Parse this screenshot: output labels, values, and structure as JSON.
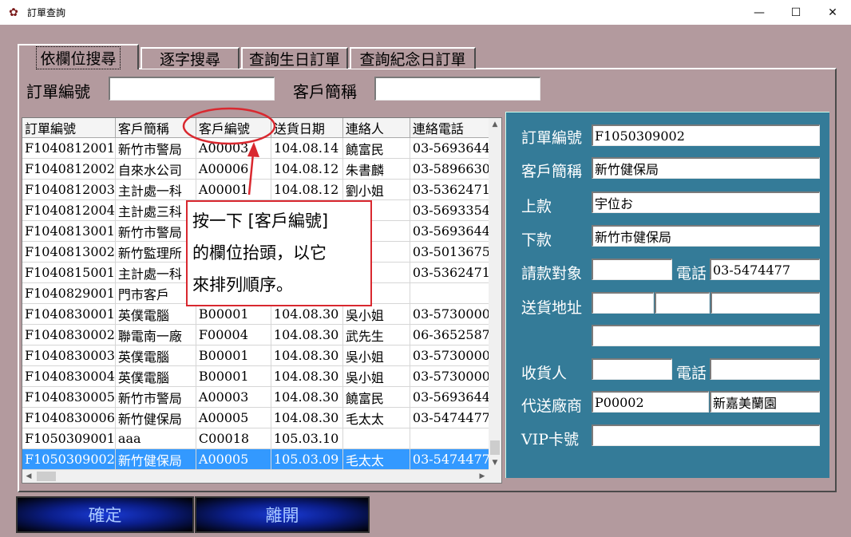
{
  "window": {
    "title": "訂單查詢",
    "minimize": "—",
    "maximize": "☐",
    "close": "✕"
  },
  "tabs": [
    {
      "label": "依欄位搜尋",
      "active": true
    },
    {
      "label": "逐字搜尋",
      "active": false
    },
    {
      "label": "查詢生日訂單",
      "active": false
    },
    {
      "label": "查詢紀念日訂單",
      "active": false
    }
  ],
  "search": {
    "order_no_label": "訂單編號",
    "order_no_value": "",
    "customer_label": "客戶簡稱",
    "customer_value": ""
  },
  "grid": {
    "columns": [
      "訂單編號",
      "客戶簡稱",
      "客戶編號",
      "送貨日期",
      "連絡人",
      "連絡電話"
    ],
    "rows": [
      [
        "F1040812001",
        "新竹市警局",
        "A00003",
        "104.08.14",
        "饒富民",
        "03-5693644"
      ],
      [
        "F1040812002",
        "自來水公司",
        "A00006",
        "104.08.12",
        "朱書麟",
        "03-5896630"
      ],
      [
        "F1040812003",
        "主計處一科",
        "A00001",
        "104.08.12",
        "劉小姐",
        "03-5362471"
      ],
      [
        "F1040812004",
        "主計處三科",
        "",
        "",
        "生",
        "03-5693354"
      ],
      [
        "F1040813001",
        "新竹市警局",
        "",
        "",
        "民",
        "03-5693644"
      ],
      [
        "F1040813002",
        "新竹監理所",
        "",
        "",
        "姐",
        "03-5013675"
      ],
      [
        "F1040815001",
        "主計處一科",
        "",
        "",
        "姐",
        "03-5362471"
      ],
      [
        "F1040829001",
        "門市客戶",
        "",
        "",
        "",
        ""
      ],
      [
        "F1040830001",
        "英僕電腦",
        "B00001",
        "104.08.30",
        "吳小姐",
        "03-5730000"
      ],
      [
        "F1040830002",
        "聯電南一廠",
        "F00004",
        "104.08.30",
        "武先生",
        "06-3652587"
      ],
      [
        "F1040830003",
        "英僕電腦",
        "B00001",
        "104.08.30",
        "吳小姐",
        "03-5730000"
      ],
      [
        "F1040830004",
        "英僕電腦",
        "B00001",
        "104.08.30",
        "吳小姐",
        "03-5730000"
      ],
      [
        "F1040830005",
        "新竹市警局",
        "A00003",
        "104.08.30",
        "饒富民",
        "03-5693644"
      ],
      [
        "F1040830006",
        "新竹健保局",
        "A00005",
        "104.08.30",
        "毛太太",
        "03-5474477"
      ],
      [
        "F1050309001",
        "aaa",
        "C00018",
        "105.03.10",
        "",
        ""
      ],
      [
        "F1050309002",
        "新竹健保局",
        "A00005",
        "105.03.09",
        "毛太太",
        "03-5474477"
      ]
    ],
    "selected_row": 15
  },
  "detail": {
    "order_no_label": "訂單編號",
    "order_no": "F1050309002",
    "customer_label": "客戶簡稱",
    "customer": "新竹健保局",
    "upper_label": "上款",
    "upper": "宇位お",
    "lower_label": "下款",
    "lower": "新竹市健保局",
    "bill_to_label": "請款對象",
    "bill_to": "",
    "phone_label": "電話",
    "phone": "03-5474477",
    "address_label": "送貨地址",
    "address_1": "",
    "address_2": "",
    "address_3": "",
    "address_4": "",
    "receiver_label": "收貨人",
    "receiver": "",
    "receiver_phone_label": "電話",
    "receiver_phone": "",
    "vendor_label": "代送廠商",
    "vendor_code": "P00002",
    "vendor_name": "新嘉美蘭園",
    "vip_label": "VIP卡號",
    "vip": ""
  },
  "buttons": {
    "ok": "確定",
    "exit": "離開"
  },
  "annotation": {
    "line1": "按一下 [客戶編號]",
    "line2": "的欄位抬頭，以它",
    "line3": "來排列順序。"
  },
  "colors": {
    "background": "#b39a9e",
    "detail_panel": "#347b98",
    "selection": "#3399ff",
    "annotation": "#d9282f"
  }
}
